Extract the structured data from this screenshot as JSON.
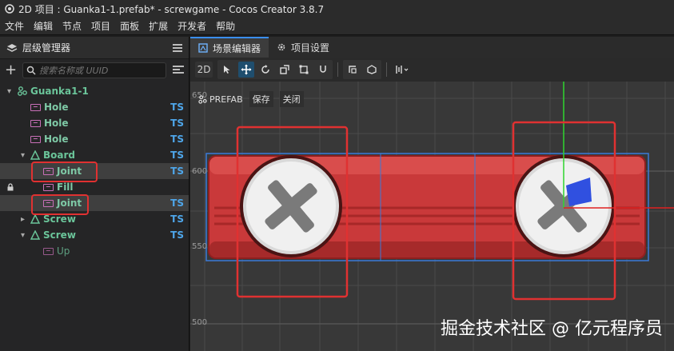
{
  "window": {
    "title": "2D 项目 : Guanka1-1.prefab* - screwgame - Cocos Creator 3.8.7"
  },
  "menu": [
    "文件",
    "编辑",
    "节点",
    "项目",
    "面板",
    "扩展",
    "开发者",
    "帮助"
  ],
  "hierarchy": {
    "title": "层级管理器",
    "search_placeholder": "搜索名称或 UUID",
    "items": [
      {
        "label": "Guanka1-1",
        "ts": ""
      },
      {
        "label": "Hole",
        "ts": "TS"
      },
      {
        "label": "Hole",
        "ts": "TS"
      },
      {
        "label": "Hole",
        "ts": "TS"
      },
      {
        "label": "Board",
        "ts": "TS"
      },
      {
        "label": "Joint",
        "ts": "TS"
      },
      {
        "label": "Fill",
        "ts": ""
      },
      {
        "label": "Joint",
        "ts": "TS"
      },
      {
        "label": "Screw",
        "ts": "TS"
      },
      {
        "label": "Screw",
        "ts": "TS"
      },
      {
        "label": "Up",
        "ts": ""
      }
    ]
  },
  "tabs": [
    {
      "label": "场景编辑器",
      "icon": "scene-editor-icon"
    },
    {
      "label": "项目设置",
      "icon": "gear-icon"
    }
  ],
  "toolbar": {
    "mode_2d": "2D"
  },
  "prefab_bar": {
    "prefix": "PREFAB",
    "save": "保存",
    "close": "关闭"
  },
  "ruler": {
    "y_650": "650",
    "y_600": "600",
    "y_550": "550",
    "y_500": "500"
  },
  "watermark": "掘金技术社区 @ 亿元程序员",
  "colors": {
    "accent": "#3a8ef0",
    "highlight_box": "#e03131",
    "node_text": "#6bc59a",
    "ts_badge": "#4ea6ea",
    "board": "#c9393a"
  }
}
